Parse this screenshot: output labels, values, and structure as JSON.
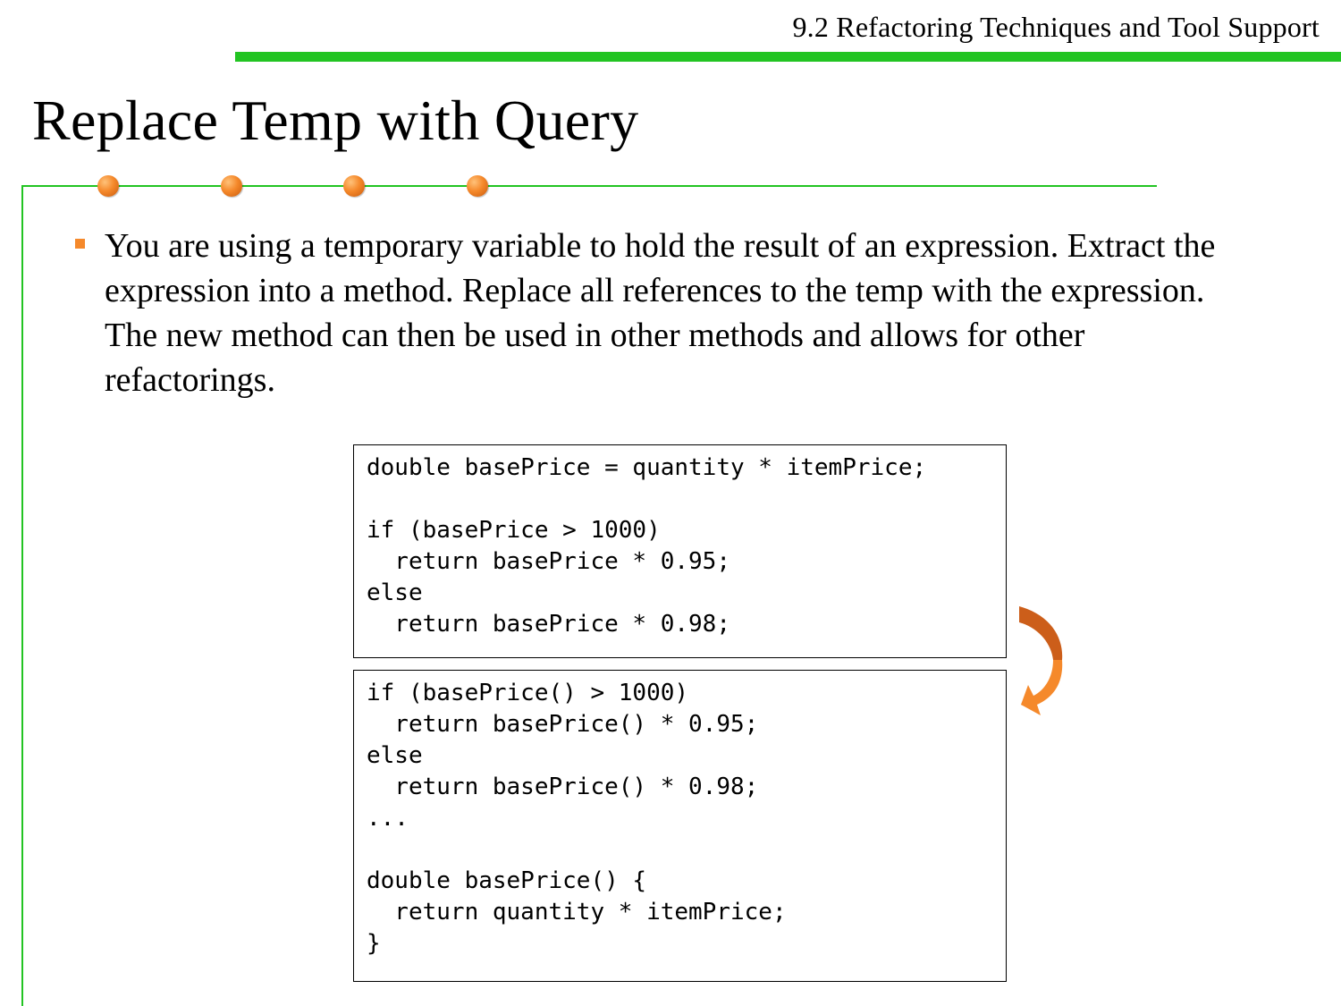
{
  "header": {
    "section": "9.2 Refactoring Techniques and Tool Support"
  },
  "slide": {
    "title": "Replace Temp with Query",
    "bullets": [
      "You are using a temporary variable to hold the result of an expression.  Extract the expression into a method. Replace all references to the temp with the expression. The new method can then be used in other methods and allows for other refactorings."
    ]
  },
  "code_before": [
    "double basePrice = quantity * itemPrice;",
    "",
    "if (basePrice > 1000)",
    "  return basePrice * 0.95;",
    "else",
    "  return basePrice * 0.98;"
  ],
  "code_after": [
    "if (basePrice() > 1000)",
    "  return basePrice() * 0.95;",
    "else",
    "  return basePrice() * 0.98;",
    "...",
    "",
    "double basePrice() {",
    "  return quantity * itemPrice;",
    "}"
  ],
  "colors": {
    "accent_green": "#22c422",
    "accent_orange": "#f5892b",
    "arrow_dark": "#cc5e1a"
  },
  "icons": {
    "transform_arrow": "curved-arrow-down-icon",
    "title_dots": "orange-circle-icon",
    "bullet": "orange-square-icon"
  }
}
